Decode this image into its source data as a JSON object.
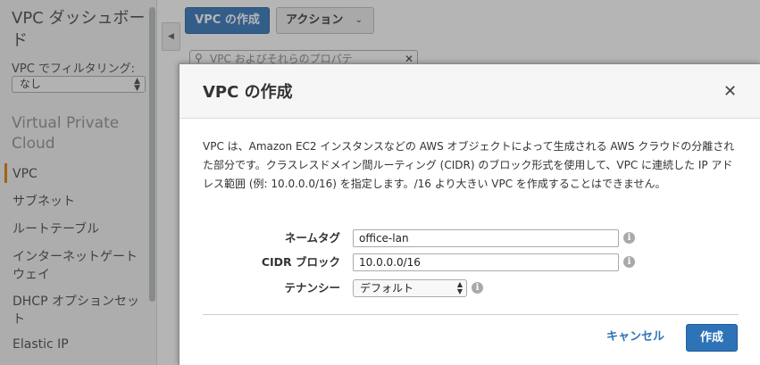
{
  "sidebar": {
    "title": "VPC ダッシュボード",
    "filter_label": "VPC でフィルタリング:",
    "filter_value": "なし",
    "section_title": "Virtual Private Cloud",
    "items": [
      {
        "label": "VPC",
        "active": true
      },
      {
        "label": "サブネット"
      },
      {
        "label": "ルートテーブル"
      },
      {
        "label": "インターネットゲートウェイ"
      },
      {
        "label": "DHCP オプションセット"
      },
      {
        "label": "Elastic IP"
      }
    ]
  },
  "toolbar": {
    "create_label": "VPC の作成",
    "action_label": "アクション"
  },
  "search": {
    "text": "VPC およびそれらのプロパテ"
  },
  "modal": {
    "title": "VPC の作成",
    "description": "VPC は、Amazon EC2 インスタンスなどの AWS オブジェクトによって生成される AWS クラウドの分離された部分です。クラスレスドメイン間ルーティング (CIDR) のブロック形式を使用して、VPC に連続した IP アドレス範囲 (例: 10.0.0.0/16) を指定します。/16 より大きい VPC を作成することはできません。",
    "fields": {
      "name_tag": {
        "label": "ネームタグ",
        "value": "office-lan"
      },
      "cidr": {
        "label": "CIDR ブロック",
        "value": "10.0.0.0/16"
      },
      "tenancy": {
        "label": "テナンシー",
        "value": "デフォルト"
      }
    },
    "cancel_label": "キャンセル",
    "create_label": "作成"
  },
  "colors": {
    "primary": "#2e73b8",
    "active_indicator": "#e07b00",
    "overlay": "rgba(60,60,60,0.38)"
  }
}
